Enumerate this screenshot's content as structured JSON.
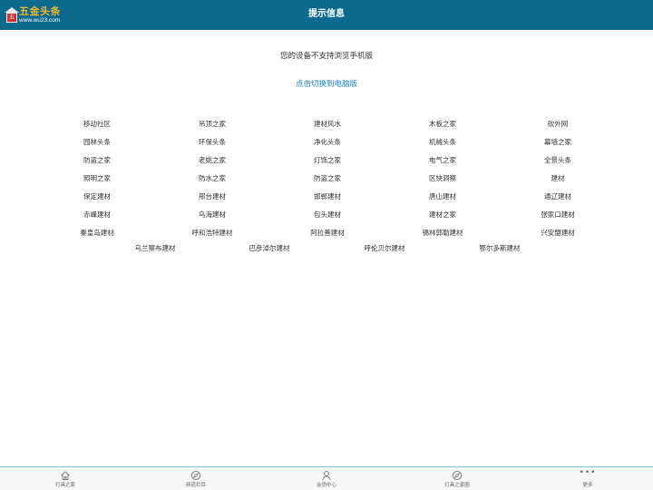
{
  "header": {
    "title": "提示信息",
    "logo": {
      "name": "五金头条",
      "url": "www.wu23.com",
      "mark_text": "五"
    }
  },
  "main": {
    "notice": "您的设备不支持浏览手机版",
    "switch_link": "点击切换到电脑版"
  },
  "links": {
    "rows": [
      [
        "移动社区",
        "吊顶之家",
        "建材风水",
        "木板之家",
        "砍外网"
      ],
      [
        "园林头条",
        "环保头条",
        "净化头条",
        "机械头条",
        "幕墙之家"
      ],
      [
        "防盗之家",
        "老姚之家",
        "灯饰之家",
        "电气之家",
        "全景头条"
      ],
      [
        "照明之家",
        "防水之家",
        "防盗之家",
        "区快洞察",
        "建材"
      ],
      [
        "保定建材",
        "邢台建材",
        "邯郸建材",
        "唐山建材",
        "通辽建材"
      ],
      [
        "赤峰建材",
        "乌海建材",
        "包头建材",
        "建材之家",
        "张家口建材"
      ],
      [
        "秦皇岛建材",
        "呼和浩特建材",
        "阿拉善建材",
        "锡林郭勒建材",
        "兴安盟建材"
      ],
      [
        "乌兰察布建材",
        "巴彦淖尔建材",
        "呼伦贝尔建材",
        "鄂尔多斯建材"
      ]
    ]
  },
  "tabbar": {
    "items": [
      {
        "label": "灯具之家",
        "icon": "home-icon"
      },
      {
        "label": "频道栏目",
        "icon": "compass-icon"
      },
      {
        "label": "会员中心",
        "icon": "user-icon"
      },
      {
        "label": "灯具之家圈",
        "icon": "compass-icon"
      },
      {
        "label": "更多",
        "icon": "more-icon"
      }
    ],
    "more_glyph": "•••"
  },
  "colors": {
    "header_bg": "#0c6a8c",
    "link_blue": "#1e88d6",
    "logo_gold": "#f2b632",
    "tabbar_border": "#7fc4df"
  }
}
